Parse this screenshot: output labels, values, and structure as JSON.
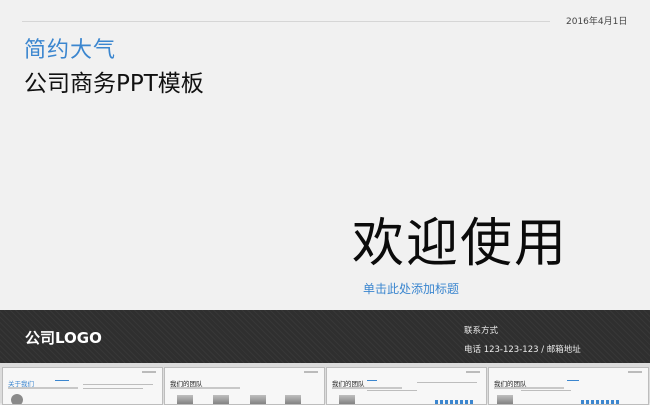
{
  "slide": {
    "date": "2016年4月1日",
    "title_line1": "简约大气",
    "title_line2": "公司商务PPT模板",
    "welcome": "欢迎使用",
    "subtitle": "单击此处添加标题"
  },
  "footer": {
    "logo": "公司LOGO",
    "contact_label": "联系方式",
    "contact_info": "电话 123-123-123 / 邮箱地址"
  },
  "thumbnails": [
    {
      "title": "关于我们"
    },
    {
      "title": "我们的团队"
    },
    {
      "title": "我们的团队"
    },
    {
      "title": "我们的团队"
    }
  ],
  "colors": {
    "accent": "#3b86cf",
    "footer_bg": "#2f2f2f",
    "slide_bg": "#f1f1f1"
  }
}
